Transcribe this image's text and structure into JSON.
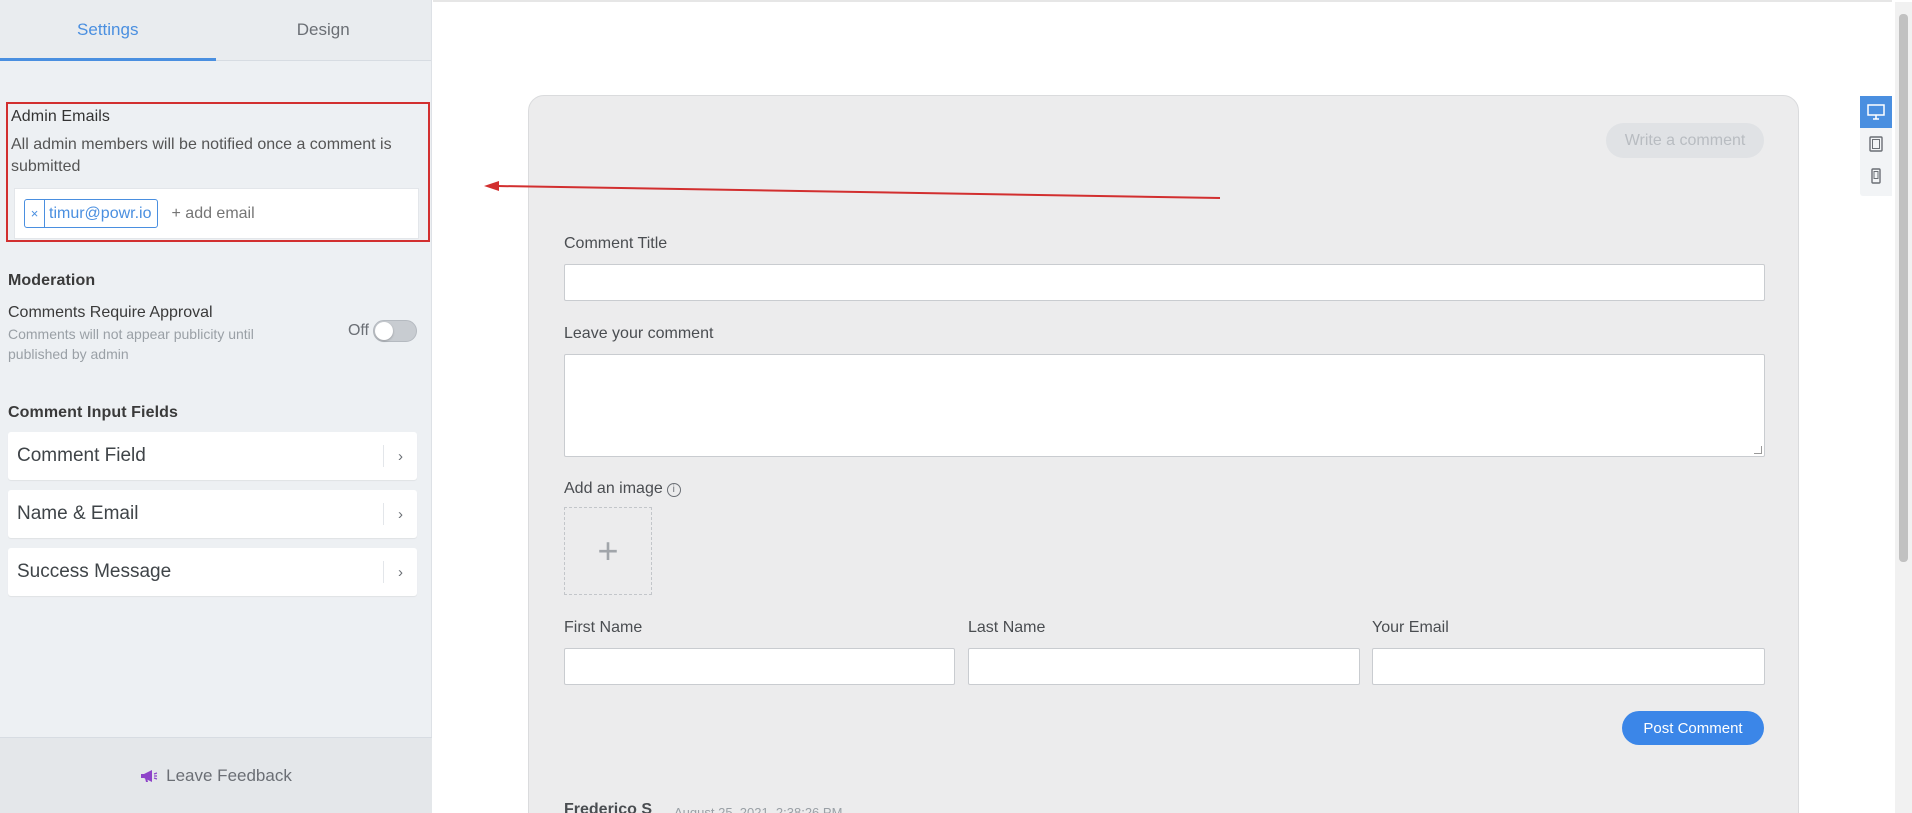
{
  "tabs": [
    {
      "label": "Settings",
      "active": true
    },
    {
      "label": "Design",
      "active": false
    }
  ],
  "admin": {
    "title": "Admin Emails",
    "description": "All admin members will be notified once a comment is submitted",
    "chip_remove": "×",
    "email": "timur@powr.io",
    "add_placeholder": "+ add email"
  },
  "moderation": {
    "title": "Moderation",
    "label": "Comments Require Approval",
    "sub": "Comments will not appear publicity until published by admin",
    "toggle_state": "Off"
  },
  "fields": {
    "title": "Comment Input Fields",
    "items": [
      {
        "label": "Comment Field"
      },
      {
        "label": "Name & Email"
      },
      {
        "label": "Success Message"
      }
    ],
    "chevron": "›"
  },
  "feedback": {
    "label": "Leave Feedback"
  },
  "preview": {
    "write_button": "Write a comment",
    "comment_title_label": "Comment Title",
    "comment_label": "Leave your comment",
    "image_label": "Add an image",
    "image_info": "i",
    "image_add": "+",
    "first_name_label": "First Name",
    "last_name_label": "Last Name",
    "email_label": "Your Email",
    "post_button": "Post Comment",
    "comment_author": "Frederico S",
    "comment_date": "August 25, 2021, 2:38:26 PM"
  },
  "colors": {
    "accent": "#4a8fe0",
    "post_button": "#3b86e8",
    "annotation": "#d22f2f",
    "feedback_icon": "#8e44c9"
  }
}
